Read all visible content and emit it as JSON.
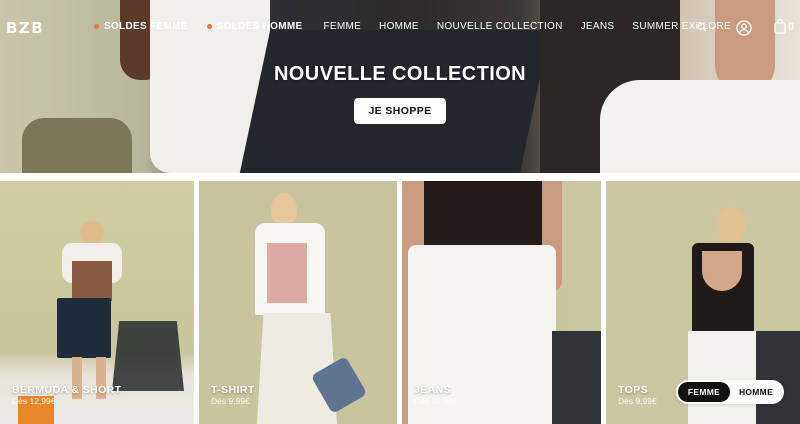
{
  "header": {
    "logo": "BZB",
    "nav": [
      {
        "label": "SOLDES FEMME",
        "highlight": true
      },
      {
        "label": "SOLDES HOMME",
        "highlight": true
      },
      {
        "label": "FEMME",
        "highlight": false
      },
      {
        "label": "HOMME",
        "highlight": false
      },
      {
        "label": "NOUVELLE COLLECTION",
        "highlight": false
      },
      {
        "label": "JEANS",
        "highlight": false
      },
      {
        "label": "SUMMER EXPLORE",
        "highlight": false
      }
    ],
    "cart_count": "0",
    "icons": [
      "search-icon",
      "account-icon",
      "cart-icon"
    ]
  },
  "hero": {
    "title": "NOUVELLE COLLECTION",
    "cta": "JE SHOPPE"
  },
  "categories": [
    {
      "title": "BERMUDA & SHORT",
      "price": "Dès 12,99€"
    },
    {
      "title": "T-SHIRT",
      "price": "Dès 9,99€"
    },
    {
      "title": "JEANS",
      "price": "Dès 39,99€"
    },
    {
      "title": "TOPS",
      "price": "Dès 9,99€"
    }
  ],
  "gender_toggle": {
    "options": [
      "FEMME",
      "HOMME"
    ],
    "selected": "FEMME"
  },
  "colors": {
    "sale_dot": "#e8763e",
    "toggle_active": "#111111"
  }
}
